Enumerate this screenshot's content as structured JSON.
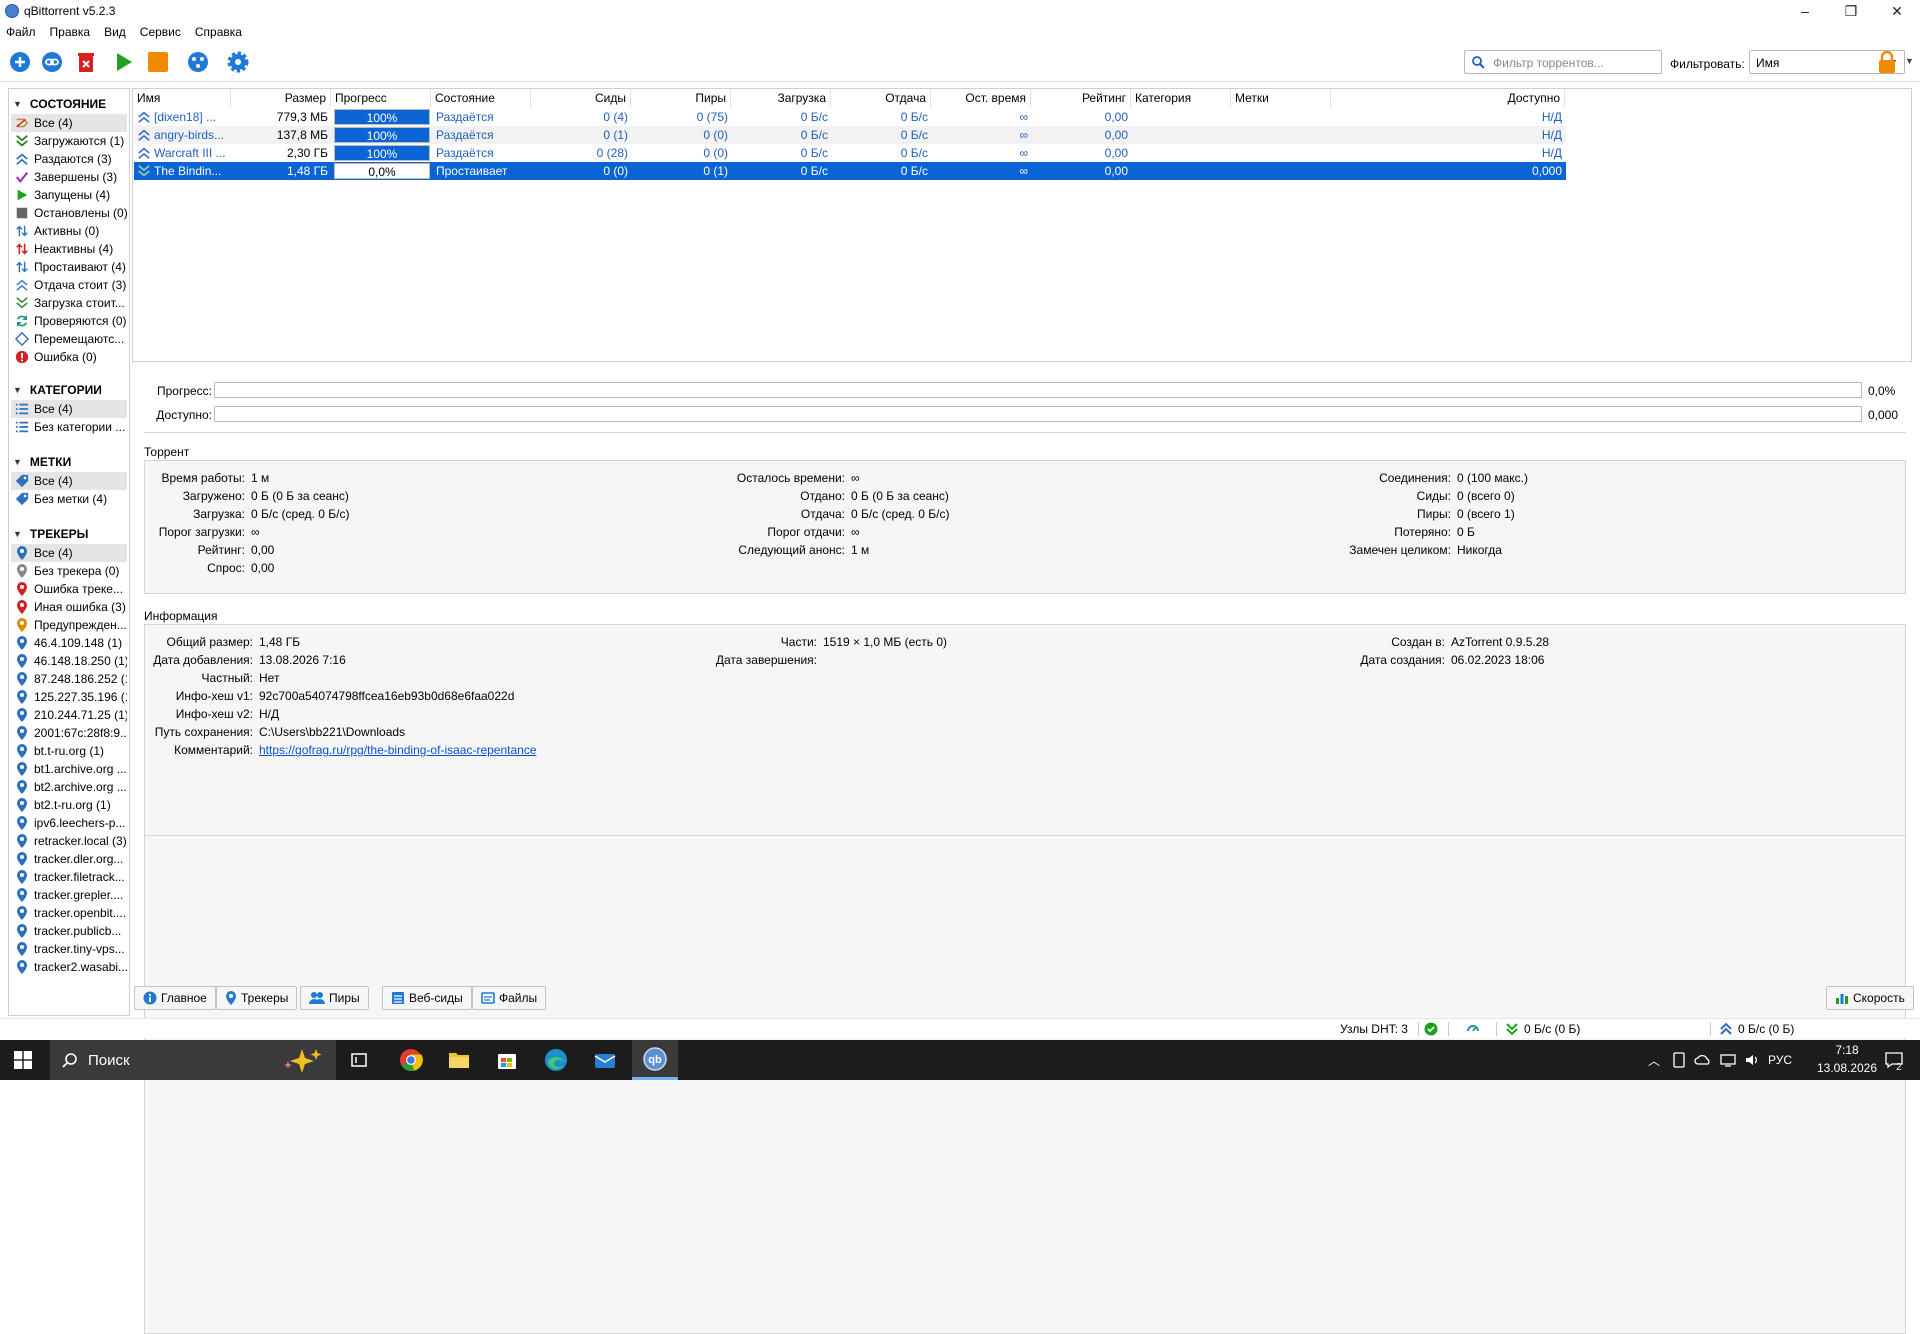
{
  "window": {
    "title": "qBittorrent v5.2.3",
    "min": "–",
    "max": "❐",
    "close": "✕"
  },
  "menu": [
    "Файл",
    "Правка",
    "Вид",
    "Сервис",
    "Справка"
  ],
  "toolbar": {
    "search_placeholder": "Фильтр торрентов...",
    "filter_label": "Фильтровать:",
    "filter_value": "Имя"
  },
  "sidebar": {
    "status_title": "СОСТОЯНИЕ",
    "status_items": [
      {
        "label": "Все (4)",
        "icon": "all-icon",
        "color": "#c28b2a"
      },
      {
        "label": "Загружаются (1)",
        "icon": "downloading-icon",
        "color": "#1e7f1e"
      },
      {
        "label": "Раздаются (3)",
        "icon": "seeding-icon",
        "color": "#2d6fc0"
      },
      {
        "label": "Завершены (3)",
        "icon": "completed-icon",
        "color": "#1e8f1e"
      },
      {
        "label": "Запущены (4)",
        "icon": "running-icon",
        "color": "#1ea01e"
      },
      {
        "label": "Остановлены (0)",
        "icon": "stopped-icon",
        "color": "#666666"
      },
      {
        "label": "Активны (0)",
        "icon": "active-icon",
        "color": "#2d6fc0"
      },
      {
        "label": "Неактивны (4)",
        "icon": "inactive-icon",
        "color": "#d02020"
      },
      {
        "label": "Простаивают (4)",
        "icon": "stalled-icon",
        "color": "#2d6fc0"
      },
      {
        "label": "Отдача стоит (3)",
        "icon": "stalled-upload-icon",
        "color": "#2d6fc0"
      },
      {
        "label": "Загрузка стоит...",
        "icon": "stalled-download-icon",
        "color": "#1e7f1e"
      },
      {
        "label": "Проверяются (0)",
        "icon": "checking-icon",
        "color": "#1e8f7f"
      },
      {
        "label": "Перемещаютс...",
        "icon": "moving-icon",
        "color": "#2d6fc0"
      },
      {
        "label": "Ошибка (0)",
        "icon": "error-icon",
        "color": "#d02020"
      }
    ],
    "categories_title": "КАТЕГОРИИ",
    "categories": [
      {
        "label": "Все (4)"
      },
      {
        "label": "Без категории ..."
      }
    ],
    "tags_title": "МЕТКИ",
    "tags": [
      {
        "label": "Все (4)"
      },
      {
        "label": "Без метки (4)"
      }
    ],
    "trackers_title": "ТРЕКЕРЫ",
    "trackers": [
      {
        "label": "Все (4)",
        "color": "#2d6fc0"
      },
      {
        "label": "Без трекера (0)",
        "color": "#888888"
      },
      {
        "label": "Ошибка треке...",
        "color": "#d02020"
      },
      {
        "label": "Иная ошибка (3)",
        "color": "#d02020"
      },
      {
        "label": "Предупрежден...",
        "color": "#e08a00"
      },
      {
        "label": "46.4.109.148 (1)",
        "color": "#2d6fc0"
      },
      {
        "label": "46.148.18.250 (1)",
        "color": "#2d6fc0"
      },
      {
        "label": "87.248.186.252 (1)",
        "color": "#2d6fc0"
      },
      {
        "label": "125.227.35.196 (1)",
        "color": "#2d6fc0"
      },
      {
        "label": "210.244.71.25 (1)",
        "color": "#2d6fc0"
      },
      {
        "label": "2001:67c:28f8:9...",
        "color": "#2d6fc0"
      },
      {
        "label": "bt.t-ru.org (1)",
        "color": "#2d6fc0"
      },
      {
        "label": "bt1.archive.org ...",
        "color": "#2d6fc0"
      },
      {
        "label": "bt2.archive.org ...",
        "color": "#2d6fc0"
      },
      {
        "label": "bt2.t-ru.org (1)",
        "color": "#2d6fc0"
      },
      {
        "label": "ipv6.leechers-p...",
        "color": "#2d6fc0"
      },
      {
        "label": "retracker.local (3)",
        "color": "#2d6fc0"
      },
      {
        "label": "tracker.dler.org...",
        "color": "#2d6fc0"
      },
      {
        "label": "tracker.filetrack...",
        "color": "#2d6fc0"
      },
      {
        "label": "tracker.grepler....",
        "color": "#2d6fc0"
      },
      {
        "label": "tracker.openbit....",
        "color": "#2d6fc0"
      },
      {
        "label": "tracker.publicb...",
        "color": "#2d6fc0"
      },
      {
        "label": "tracker.tiny-vps...",
        "color": "#2d6fc0"
      },
      {
        "label": "tracker2.wasabi...",
        "color": "#2d6fc0"
      }
    ]
  },
  "columns": [
    "Имя",
    "Размер",
    "Прогресс",
    "Состояние",
    "Сиды",
    "Пиры",
    "Загрузка",
    "Отдача",
    "Ост. время",
    "Рейтинг",
    "Категория",
    "Метки",
    "Доступно"
  ],
  "torrents": [
    {
      "name": "[dixen18] ...",
      "size": "779,3 МБ",
      "progress": 1.0,
      "progress_text": "100%",
      "status": "Раздаётся",
      "seeds": "0 (4)",
      "peers": "0 (75)",
      "down": "0 Б/с",
      "up": "0 Б/с",
      "eta": "∞",
      "ratio": "0,00",
      "category": "",
      "tags": "",
      "avail": "Н/Д"
    },
    {
      "name": "angry-birds...",
      "size": "137,8 МБ",
      "progress": 1.0,
      "progress_text": "100%",
      "status": "Раздаётся",
      "seeds": "0 (1)",
      "peers": "0 (0)",
      "down": "0 Б/с",
      "up": "0 Б/с",
      "eta": "∞",
      "ratio": "0,00",
      "category": "",
      "tags": "",
      "avail": "Н/Д"
    },
    {
      "name": "Warcraft III ...",
      "size": "2,30 ГБ",
      "progress": 1.0,
      "progress_text": "100%",
      "status": "Раздаётся",
      "seeds": "0 (28)",
      "peers": "0 (0)",
      "down": "0 Б/с",
      "up": "0 Б/с",
      "eta": "∞",
      "ratio": "0,00",
      "category": "",
      "tags": "",
      "avail": "Н/Д"
    },
    {
      "name": "The Bindin...",
      "size": "1,48 ГБ",
      "progress": 0.0,
      "progress_text": "0,0%",
      "status": "Простаивает",
      "seeds": "0 (0)",
      "peers": "0 (1)",
      "down": "0 Б/с",
      "up": "0 Б/с",
      "eta": "∞",
      "ratio": "0,00",
      "category": "",
      "tags": "",
      "avail": "0,000"
    }
  ],
  "details": {
    "progress_label": "Прогресс:",
    "progress_value": "0,0%",
    "avail_label": "Доступно:",
    "avail_value": "0,000",
    "torrent_title": "Торрент",
    "torrent_rows": [
      [
        {
          "l": "Время работы:",
          "v": "1 м"
        },
        {
          "l": "Осталось времени:",
          "v": "∞"
        },
        {
          "l": "Соединения:",
          "v": "0 (100 макс.)"
        }
      ],
      [
        {
          "l": "Загружено:",
          "v": "0 Б (0 Б за сеанс)"
        },
        {
          "l": "Отдано:",
          "v": "0 Б (0 Б за сеанс)"
        },
        {
          "l": "Сиды:",
          "v": "0 (всего 0)"
        }
      ],
      [
        {
          "l": "Загрузка:",
          "v": "0 Б/с (сред. 0 Б/с)"
        },
        {
          "l": "Отдача:",
          "v": "0 Б/с (сред. 0 Б/с)"
        },
        {
          "l": "Пиры:",
          "v": "0 (всего 1)"
        }
      ],
      [
        {
          "l": "Порог загрузки:",
          "v": "∞"
        },
        {
          "l": "Порог отдачи:",
          "v": "∞"
        },
        {
          "l": "Потеряно:",
          "v": "0 Б"
        }
      ],
      [
        {
          "l": "Рейтинг:",
          "v": "0,00"
        },
        {
          "l": "Следующий анонс:",
          "v": "1 м"
        },
        {
          "l": "Замечен целиком:",
          "v": "Никогда"
        }
      ],
      [
        {
          "l": "Спрос:",
          "v": "0,00"
        }
      ]
    ],
    "info_title": "Информация",
    "info_rows": [
      [
        {
          "l": "Общий размер:",
          "v": "1,48 ГБ"
        },
        {
          "l": "Части:",
          "v": "1519 × 1,0 МБ (есть 0)"
        },
        {
          "l": "Создан в:",
          "v": "AzTorrent 0.9.5.28"
        }
      ],
      [
        {
          "l": "Дата добавления:",
          "v": "13.08.2026 7:16"
        },
        {
          "l": "Дата завершения:",
          "v": ""
        },
        {
          "l": "Дата создания:",
          "v": "06.02.2023 18:06"
        }
      ],
      [
        {
          "l": "Частный:",
          "v": "Нет"
        }
      ],
      [
        {
          "l": "Инфо-хеш v1:",
          "v": "92c700a54074798ffcea16eb93b0d68e6faa022d"
        }
      ],
      [
        {
          "l": "Инфо-хеш v2:",
          "v": "Н/Д"
        }
      ],
      [
        {
          "l": "Путь сохранения:",
          "v": "C:\\Users\\bb221\\Downloads"
        }
      ],
      [
        {
          "l": "Комментарий:",
          "v": "https://gofrag.ru/rpg/the-binding-of-isaac-repentance"
        }
      ]
    ]
  },
  "tabs": [
    "Главное",
    "Трекеры",
    "Пиры",
    "Веб-сиды",
    "Файлы"
  ],
  "speed_tab": "Скорость",
  "status_bar": {
    "dht": "Узлы DHT: 3",
    "down": "0 Б/с (0 Б)",
    "up": "0 Б/с (0 Б)"
  },
  "taskbar": {
    "search": "Поиск",
    "lang": "РУС",
    "time": "7:18",
    "date": "13.08.2026",
    "notif": "2"
  },
  "colors": {
    "accent": "#0a64d4",
    "link": "#0b4ed8"
  }
}
